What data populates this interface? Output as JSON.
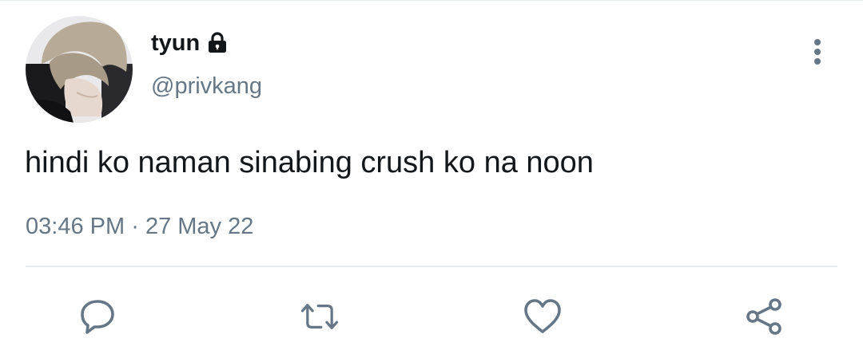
{
  "tweet": {
    "author": {
      "display_name": "tyun",
      "handle": "@privkang",
      "protected_icon": "lock-icon",
      "avatar_icon": "avatar"
    },
    "text": "hindi ko naman sinabing crush ko na noon",
    "time": "03:46 PM",
    "separator": "·",
    "date": "27 May 22",
    "more_icon": "more-vertical-icon"
  },
  "actions": [
    {
      "name": "reply",
      "icon": "reply-icon"
    },
    {
      "name": "retweet",
      "icon": "retweet-icon"
    },
    {
      "name": "like",
      "icon": "heart-icon"
    },
    {
      "name": "share",
      "icon": "share-icon"
    }
  ],
  "colors": {
    "text": "#14171a",
    "secondary": "#657786",
    "divider": "#e6ecf0",
    "icon": "#657786"
  }
}
